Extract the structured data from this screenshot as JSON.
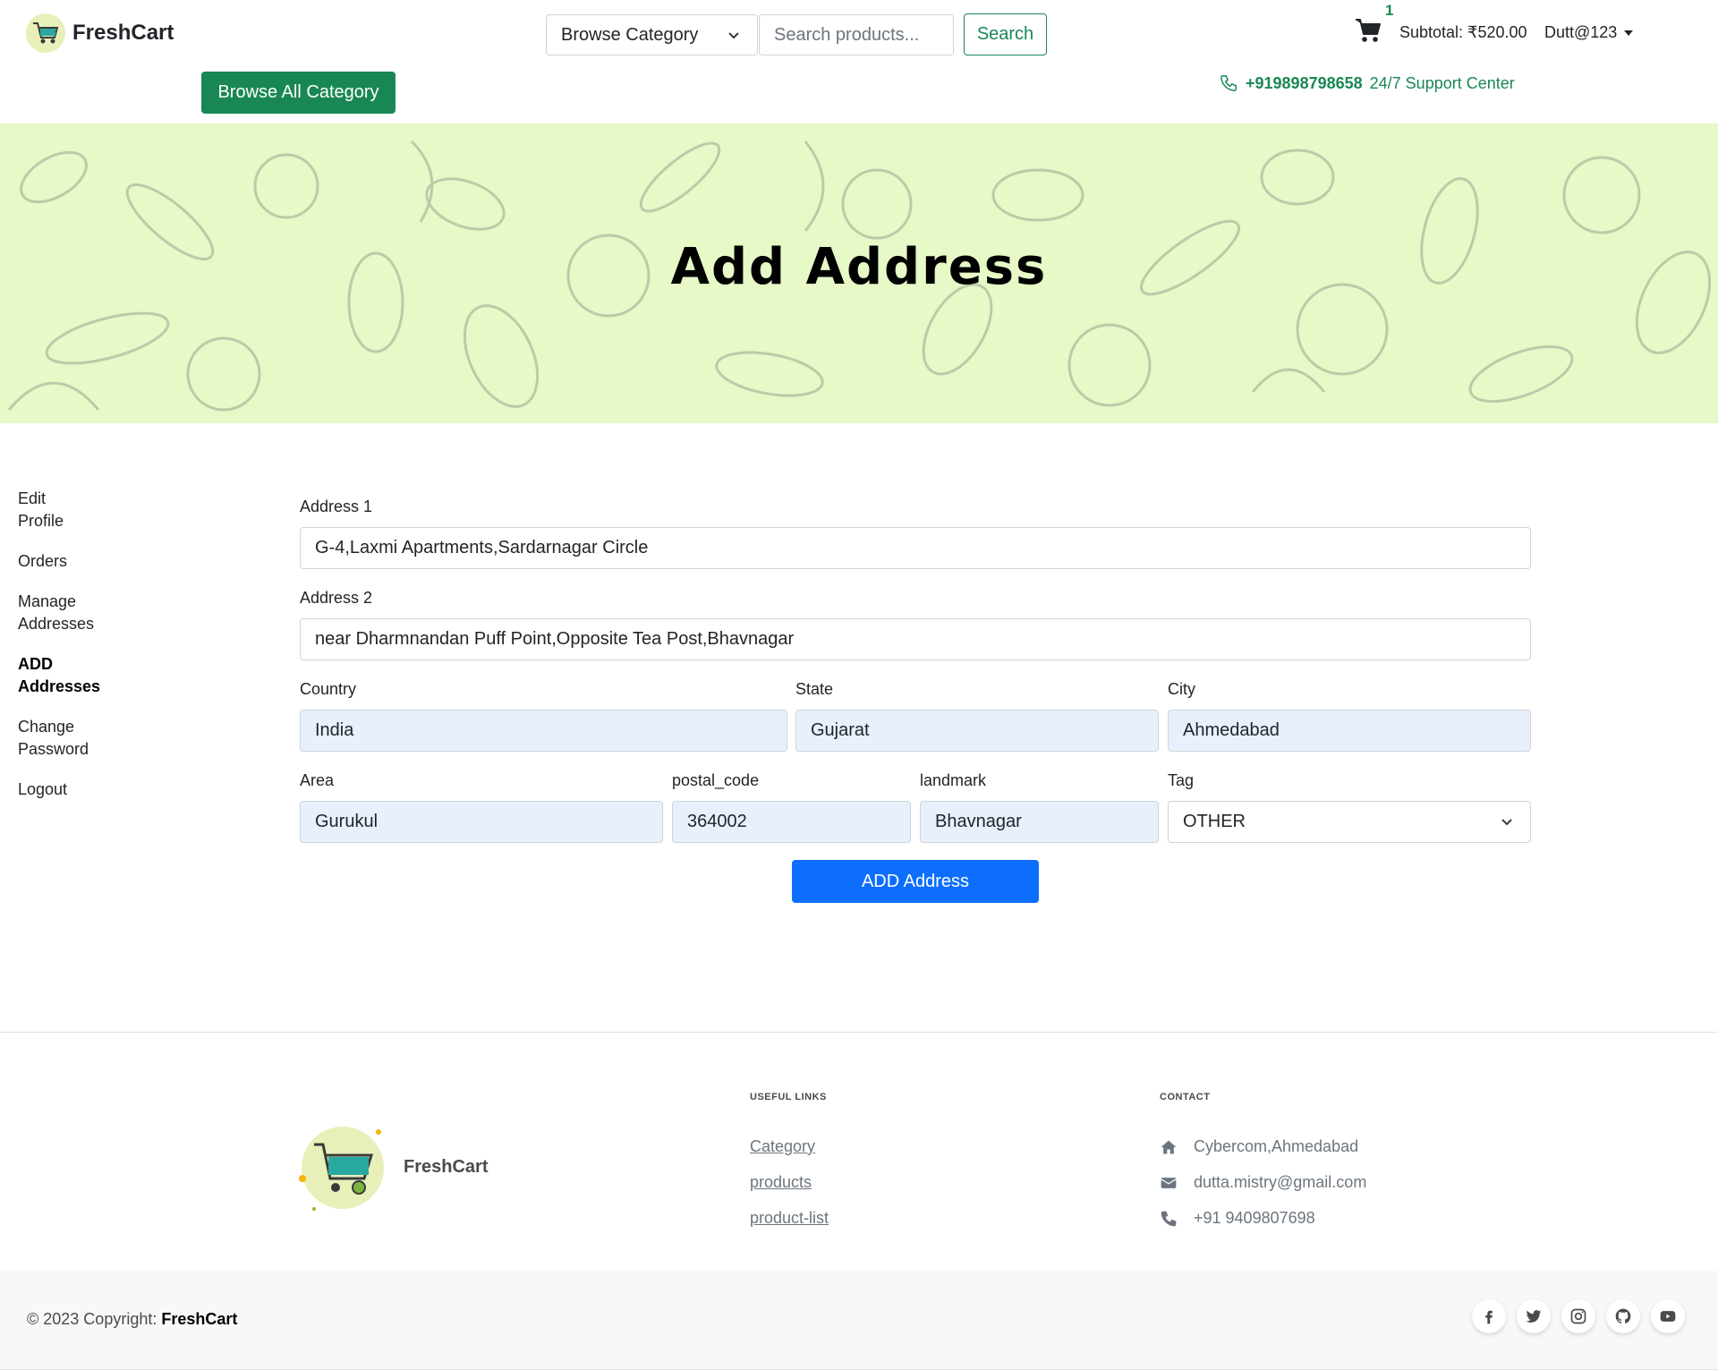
{
  "header": {
    "brand": "FreshCart",
    "browse_all_label": "Browse All Category",
    "category_select": "Browse Category",
    "search_placeholder": "Search products...",
    "search_label": "Search",
    "cart_count": "1",
    "subtotal": "Subtotal: ₹520.00",
    "username": "Dutt@123",
    "support_phone": "+919898798658",
    "support_text": "24/7 Support Center"
  },
  "banner": {
    "title": "Add Address"
  },
  "sidebar": {
    "items": [
      {
        "line1": "Edit",
        "line2": "Profile"
      },
      {
        "line1": "Orders",
        "line2": ""
      },
      {
        "line1": "Manage",
        "line2": "Addresses"
      },
      {
        "line1": "ADD",
        "line2": "Addresses"
      },
      {
        "line1": "Change",
        "line2": "Password"
      },
      {
        "line1": "Logout",
        "line2": ""
      }
    ]
  },
  "form": {
    "address1_label": "Address 1",
    "address1_value": "G-4,Laxmi Apartments,Sardarnagar Circle",
    "address2_label": "Address 2",
    "address2_value": "near Dharmnandan Puff Point,Opposite Tea Post,Bhavnagar",
    "country_label": "Country",
    "country_value": "India",
    "state_label": "State",
    "state_value": "Gujarat",
    "city_label": "City",
    "city_value": "Ahmedabad",
    "area_label": "Area",
    "area_value": "Gurukul",
    "postal_label": "postal_code",
    "postal_value": "364002",
    "landmark_label": "landmark",
    "landmark_value": "Bhavnagar",
    "tag_label": "Tag",
    "tag_value": "OTHER",
    "submit_label": "ADD Address"
  },
  "footer": {
    "brand": "FreshCart",
    "useful_links_heading": "USEFUL LINKS",
    "links": [
      "Category",
      "products",
      "product-list"
    ],
    "contact_heading": "CONTACT",
    "address": "Cybercom,Ahmedabad",
    "email": "dutta.mistry@gmail.com",
    "phone": "+91 9409807698",
    "copyright_prefix": "© 2023 Copyright: ",
    "copyright_brand": "FreshCart",
    "socials": [
      "facebook-icon",
      "twitter-icon",
      "instagram-icon",
      "github-icon",
      "youtube-icon"
    ]
  },
  "colors": {
    "brand_green": "#198754",
    "primary_blue": "#0d6efd",
    "banner_bg": "#e6f9c6",
    "autofill_bg": "#e8f0fe"
  }
}
